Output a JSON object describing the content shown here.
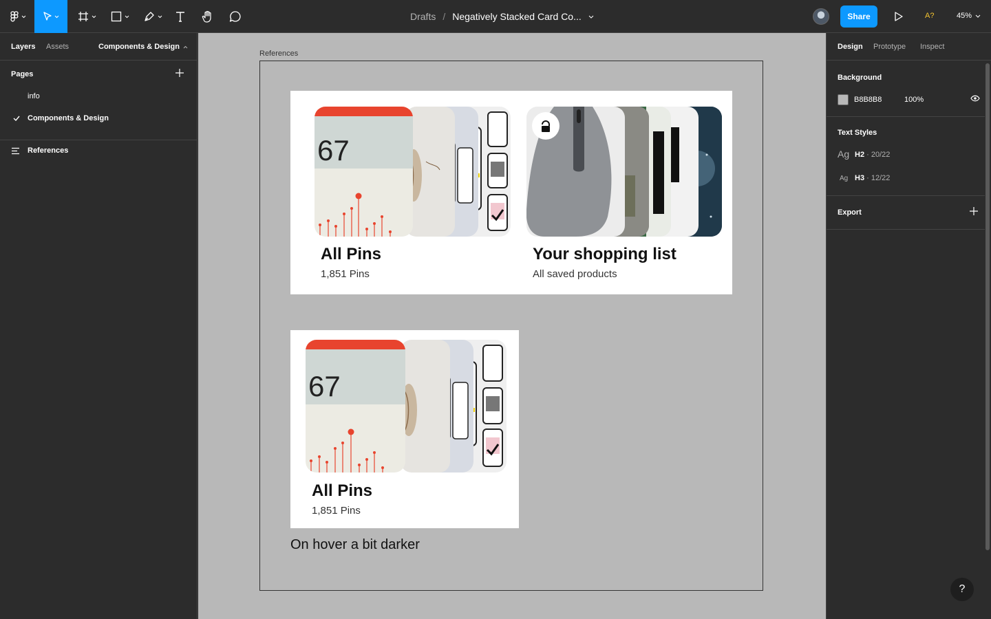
{
  "toolbar": {
    "breadcrumb": "Drafts",
    "separator": "/",
    "file_title": "Negatively Stacked Card Co...",
    "share_label": "Share",
    "font_warning": "A?",
    "zoom": "45%"
  },
  "left_panel": {
    "tabs": [
      "Layers",
      "Assets"
    ],
    "current_page_selector": "Components & Design",
    "pages_heading": "Pages",
    "pages": [
      "info",
      "Components & Design"
    ],
    "layers": [
      "References"
    ]
  },
  "canvas": {
    "frame_label": "References",
    "background_hex": "#b8b8b8",
    "cards": [
      {
        "title": "All Pins",
        "subtitle": "1,851 Pins",
        "cover_number": "67"
      },
      {
        "title": "Your shopping list",
        "subtitle": "All saved products"
      },
      {
        "title": "All Pins",
        "subtitle": "1,851 Pins",
        "cover_number": "67"
      }
    ],
    "note": "On hover a bit darker"
  },
  "right_panel": {
    "tabs": [
      "Design",
      "Prototype",
      "Inspect"
    ],
    "background_heading": "Background",
    "background_hex": "B8B8B8",
    "background_opacity": "100%",
    "text_styles_heading": "Text Styles",
    "text_styles": [
      {
        "sample": "Ag",
        "name": "H2",
        "spec": "· 20/22"
      },
      {
        "sample": "Ag",
        "name": "H3",
        "spec": "· 12/22"
      }
    ],
    "export_heading": "Export"
  },
  "help_label": "?",
  "colors": {
    "accent": "#0d99ff",
    "panel": "#2c2c2c",
    "canvas": "#b8b8b8",
    "warning": "#f4c430",
    "cover_red": "#e8442e"
  }
}
